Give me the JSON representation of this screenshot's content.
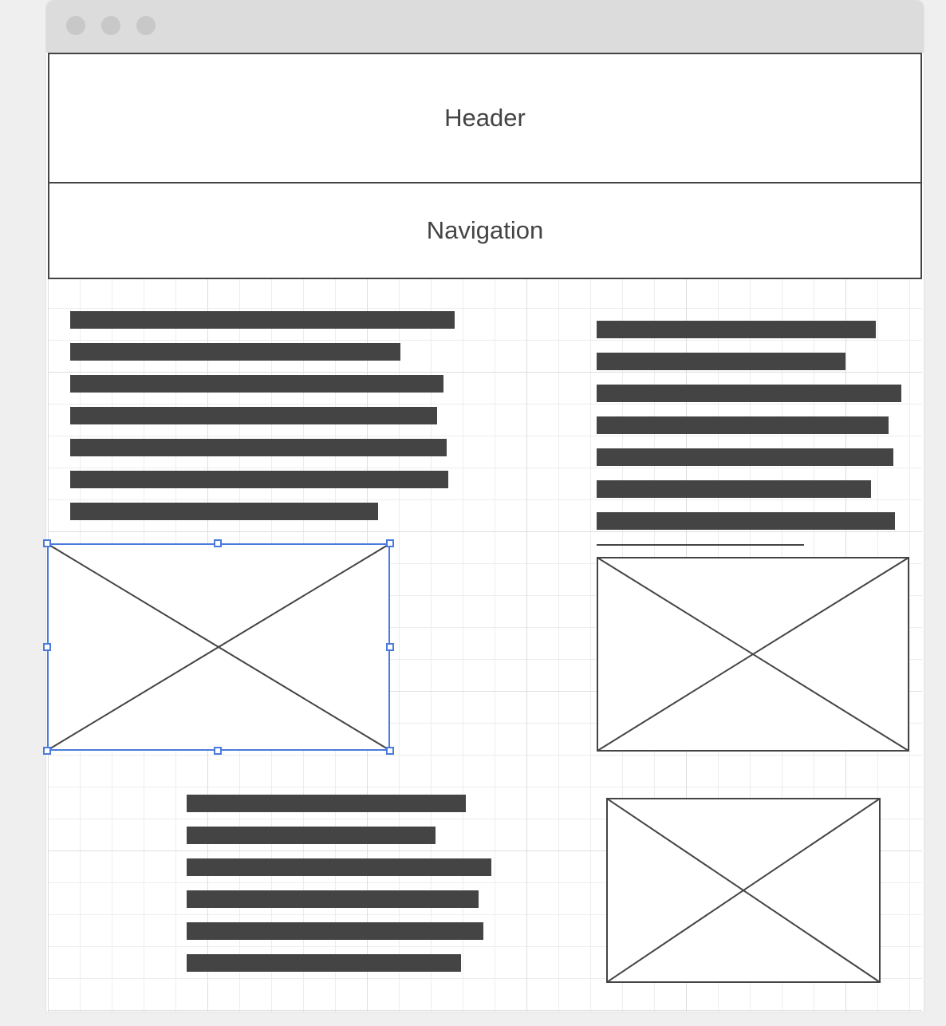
{
  "window": {
    "controls": [
      "close-dot",
      "minimize-dot",
      "maximize-dot"
    ]
  },
  "wireframe": {
    "header_label": "Header",
    "navigation_label": "Navigation"
  },
  "colors": {
    "ink": "#444444",
    "selection": "#4a7bdc",
    "grid_minor": "#ededed",
    "grid_major": "#dedede",
    "titlebar": "#dcdcdc"
  }
}
